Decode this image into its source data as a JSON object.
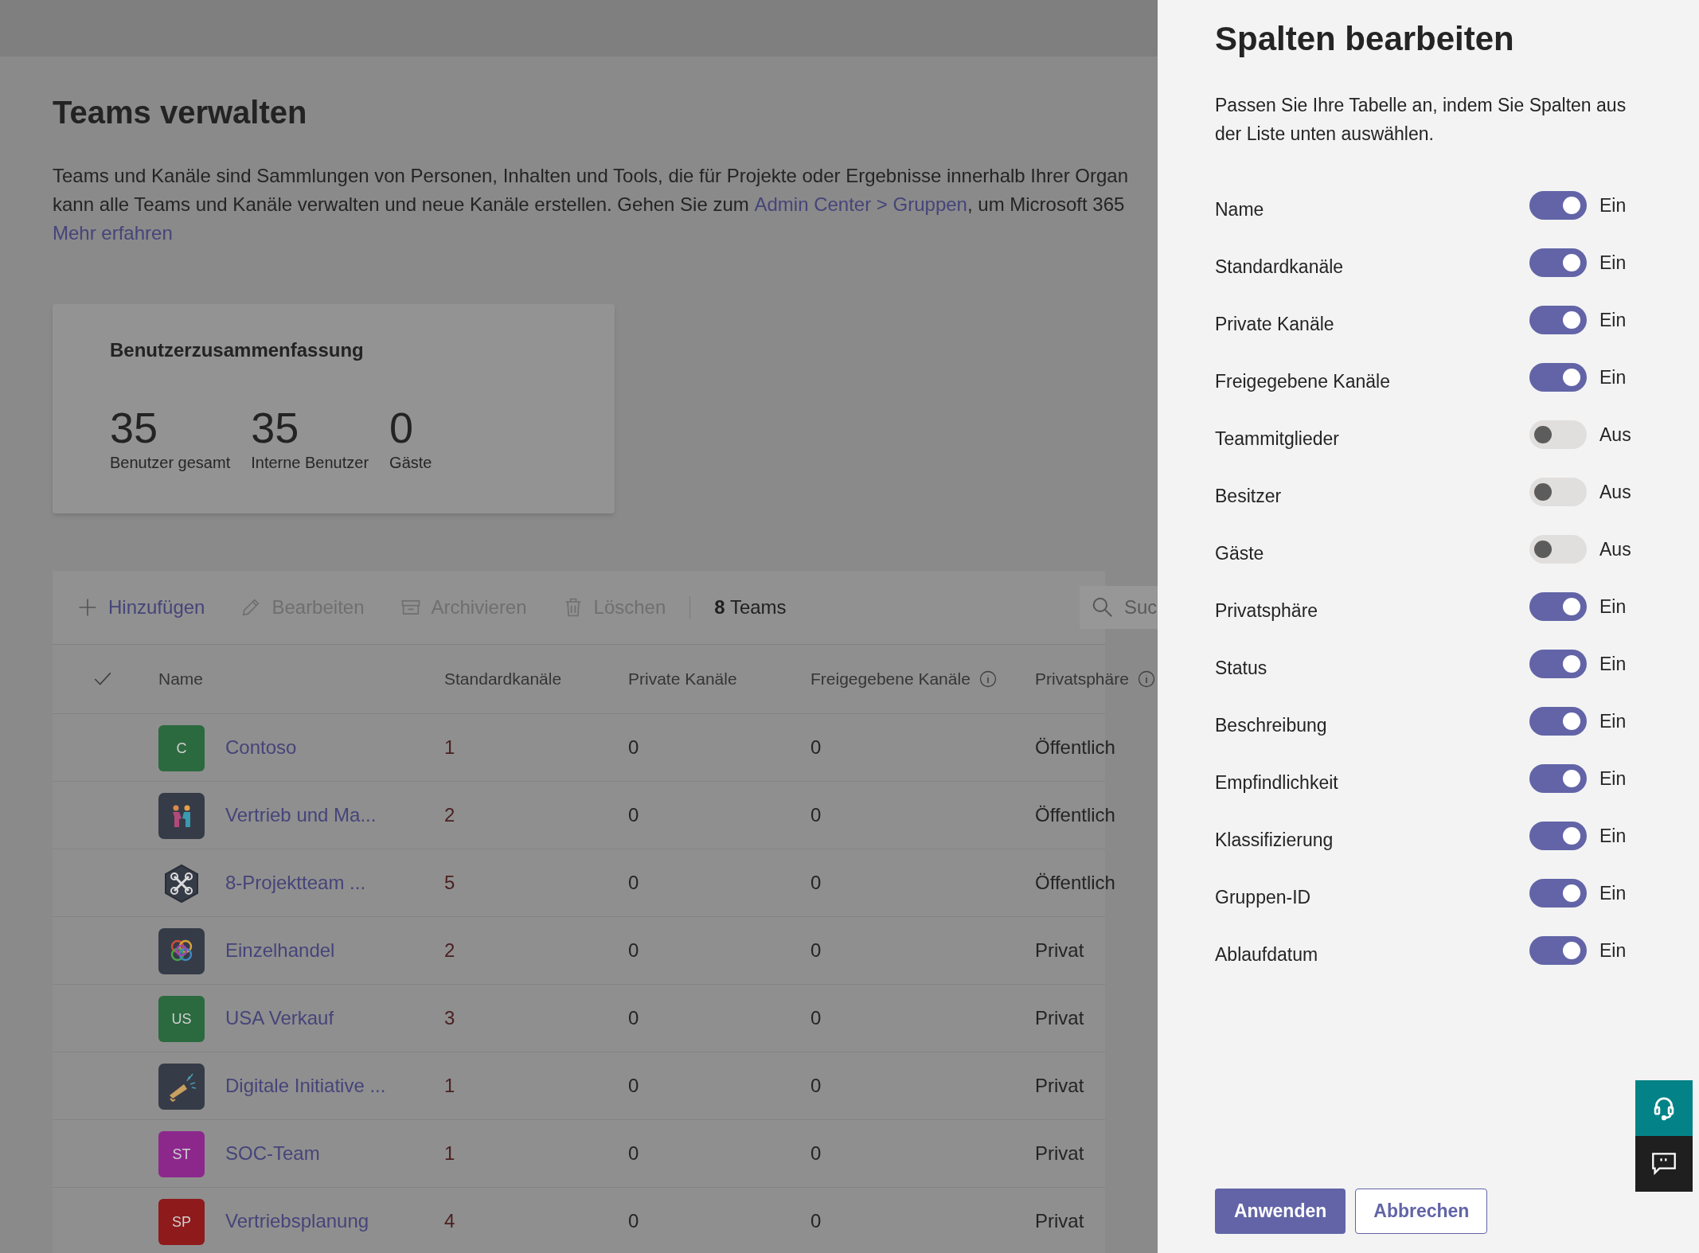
{
  "page": {
    "title": "Teams verwalten",
    "description": {
      "line_1": "Teams und Kanäle sind Sammlungen von Personen, Inhalten und Tools, die für Projekte oder Ergebnisse innerhalb Ihrer Organ",
      "line_2_before": "kann alle Teams und Kanäle verwalten und neue Kanäle erstellen. Gehen Sie zum ",
      "link": "Admin Center > Gruppen",
      "line_2_after": ", um Microsoft 365"
    },
    "learn_more": "Mehr erfahren"
  },
  "summary": {
    "title": "Benutzerzusammenfassung",
    "stats": [
      {
        "value": "35",
        "label": "Benutzer gesamt"
      },
      {
        "value": "35",
        "label": "Interne Benutzer"
      },
      {
        "value": "0",
        "label": "Gäste"
      }
    ]
  },
  "toolbar": {
    "actions": [
      {
        "kind": "add",
        "label": "Hinzufügen",
        "disabled": false
      },
      {
        "kind": "edit",
        "label": "Bearbeiten",
        "disabled": true
      },
      {
        "kind": "archive",
        "label": "Archivieren",
        "disabled": true
      },
      {
        "kind": "delete",
        "label": "Löschen",
        "disabled": true
      }
    ],
    "count": "**8** Teams",
    "search": {
      "placeholder": "Suc"
    }
  },
  "table": {
    "columns": [
      {
        "label": "Name",
        "info": false
      },
      {
        "label": "Standardkanäle",
        "info": false
      },
      {
        "label": "Private Kanäle",
        "info": false
      },
      {
        "label": "Freigegebene Kanäle",
        "info": true
      },
      {
        "label": "Privatsphäre",
        "info": true
      }
    ],
    "rows": [
      {
        "avatar": {
          "kind": "initials",
          "text": "C",
          "color": "#2b6a3f"
        },
        "name": "Contoso",
        "standard": "1",
        "private": "0",
        "shared": "0",
        "privacy": "Öffentlich"
      },
      {
        "avatar": {
          "kind": "handshake",
          "color": "#363b48"
        },
        "name": "Vertrieb und Ma...",
        "standard": "2",
        "private": "0",
        "shared": "0",
        "privacy": "Öffentlich"
      },
      {
        "avatar": {
          "kind": "drone",
          "color": "#363b48"
        },
        "name": "8-Projektteam ...",
        "standard": "5",
        "private": "0",
        "shared": "0",
        "privacy": "Öffentlich"
      },
      {
        "avatar": {
          "kind": "knot",
          "color": "#363b48"
        },
        "name": "Einzelhandel",
        "standard": "2",
        "private": "0",
        "shared": "0",
        "privacy": "Privat"
      },
      {
        "avatar": {
          "kind": "initials",
          "text": "US",
          "color": "#2b6a3f"
        },
        "name": "USA Verkauf",
        "standard": "3",
        "private": "0",
        "shared": "0",
        "privacy": "Privat"
      },
      {
        "avatar": {
          "kind": "megaphone",
          "color": "#363b48"
        },
        "name": "Digitale Initiative ...",
        "standard": "1",
        "private": "0",
        "shared": "0",
        "privacy": "Privat"
      },
      {
        "avatar": {
          "kind": "initials",
          "text": "ST",
          "color": "#8c288c"
        },
        "name": "SOC-Team",
        "standard": "1",
        "private": "0",
        "shared": "0",
        "privacy": "Privat"
      },
      {
        "avatar": {
          "kind": "initials",
          "text": "SP",
          "color": "#8e1a1c"
        },
        "name": "Vertriebsplanung",
        "standard": "4",
        "private": "0",
        "shared": "0",
        "privacy": "Privat"
      }
    ]
  },
  "panel": {
    "title": "Spalten bearbeiten",
    "description": "Passen Sie Ihre Tabelle an, indem Sie Spalten aus der Liste unten auswählen.",
    "columns": [
      {
        "label": "Name",
        "on": true,
        "state_label": "Ein"
      },
      {
        "label": "Standardkanäle",
        "on": true,
        "state_label": "Ein"
      },
      {
        "label": "Private Kanäle",
        "on": true,
        "state_label": "Ein"
      },
      {
        "label": "Freigegebene Kanäle",
        "on": true,
        "state_label": "Ein"
      },
      {
        "label": "Teammitglieder",
        "on": false,
        "state_label": "Aus"
      },
      {
        "label": "Besitzer",
        "on": false,
        "state_label": "Aus"
      },
      {
        "label": "Gäste",
        "on": false,
        "state_label": "Aus"
      },
      {
        "label": "Privatsphäre",
        "on": true,
        "state_label": "Ein"
      },
      {
        "label": "Status",
        "on": true,
        "state_label": "Ein"
      },
      {
        "label": "Beschreibung",
        "on": true,
        "state_label": "Ein"
      },
      {
        "label": "Empfindlichkeit",
        "on": true,
        "state_label": "Ein"
      },
      {
        "label": "Klassifizierung",
        "on": true,
        "state_label": "Ein"
      },
      {
        "label": "Gruppen-ID",
        "on": true,
        "state_label": "Ein"
      },
      {
        "label": "Ablaufdatum",
        "on": true,
        "state_label": "Ein"
      }
    ],
    "buttons": [
      {
        "kind": "primary",
        "label": "Anwenden"
      },
      {
        "kind": "secondary",
        "label": "Abbrechen"
      }
    ]
  }
}
